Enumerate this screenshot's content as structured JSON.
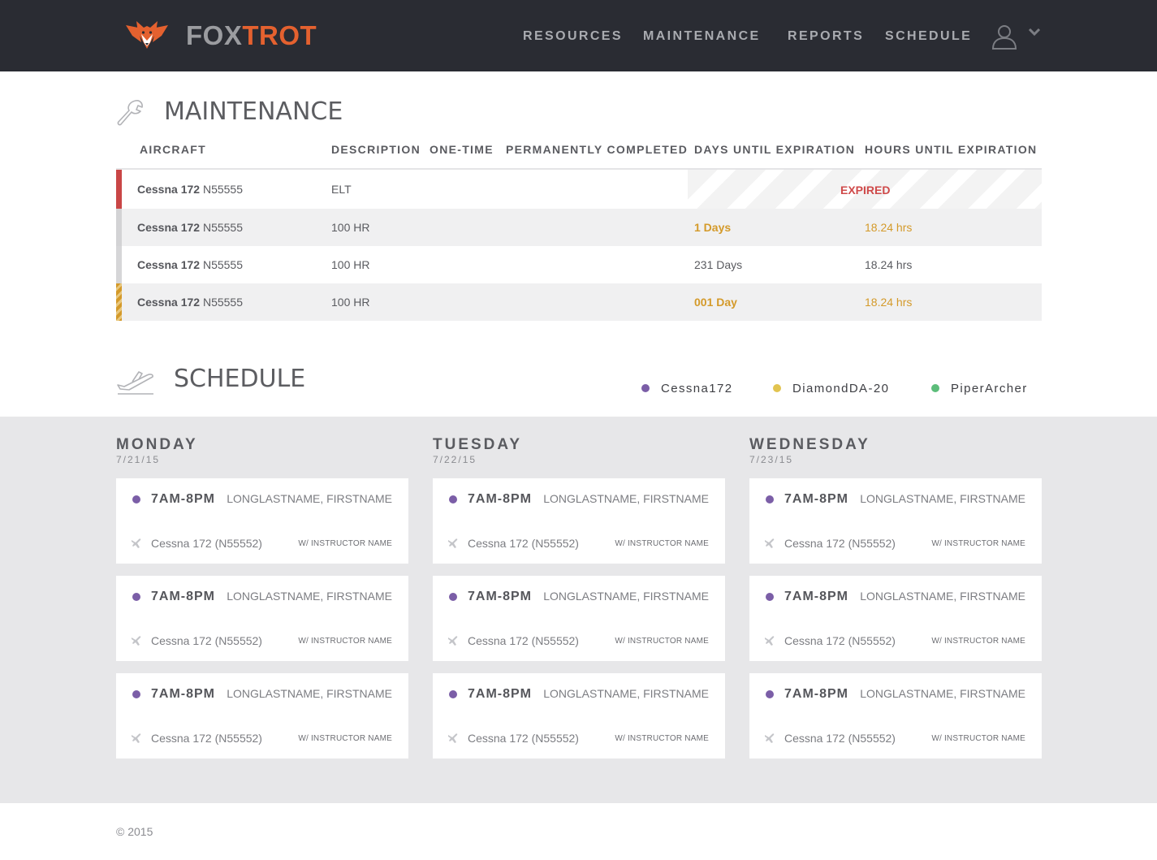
{
  "brand": {
    "name_part1": "FOX",
    "name_part2": "TROT"
  },
  "nav": {
    "items": [
      "RESOURCES",
      "MAINTENANCE",
      "REPORTS",
      "SCHEDULE"
    ]
  },
  "maintenance": {
    "title": "MAINTENANCE",
    "columns": [
      "AIRCRAFT",
      "DESCRIPTION",
      "ONE-TIME",
      "PERMANENTLY COMPLETED",
      "DAYS UNTIL EXPIRATION",
      "HOURS UNTIL EXPIRATION"
    ],
    "rows": [
      {
        "aircraft_model": "Cessna 172",
        "aircraft_reg": "N55555",
        "description": "ELT",
        "one_time": "",
        "permanently_completed": "",
        "days": "",
        "hours": "",
        "status_text": "EXPIRED",
        "status": "expired"
      },
      {
        "aircraft_model": "Cessna 172",
        "aircraft_reg": "N55555",
        "description": "100 HR",
        "one_time": "",
        "permanently_completed": "",
        "days": "1 Days",
        "hours": "18.24 hrs",
        "status_text": "",
        "status": "warning"
      },
      {
        "aircraft_model": "Cessna 172",
        "aircraft_reg": "N55555",
        "description": "100 HR",
        "one_time": "",
        "permanently_completed": "",
        "days": "231 Days",
        "hours": "18.24 hrs",
        "status_text": "",
        "status": "ok"
      },
      {
        "aircraft_model": "Cessna 172",
        "aircraft_reg": "N55555",
        "description": "100 HR",
        "one_time": "",
        "permanently_completed": "",
        "days": "001 Day",
        "hours": "18.24 hrs",
        "status_text": "",
        "status": "warning-striped"
      }
    ],
    "colors": {
      "expired": "#c94646",
      "warning": "#d49a2a",
      "ok": "#d6d6d8"
    }
  },
  "schedule": {
    "title": "SCHEDULE",
    "legend": [
      {
        "label": "Cessna172",
        "color": "#7b5ea7"
      },
      {
        "label": "DiamondDA-20",
        "color": "#e2c450"
      },
      {
        "label": "PiperArcher",
        "color": "#5cbd7a"
      }
    ],
    "days": [
      {
        "name": "MONDAY",
        "date": "7/21/15",
        "bookings": [
          {
            "time": "7AM-8PM",
            "person": "LONGLASTNAME, FIRSTNAME",
            "aircraft": "Cessna 172 (N55552)",
            "instructor": "W/ INSTRUCTOR NAME"
          },
          {
            "time": "7AM-8PM",
            "person": "LONGLASTNAME, FIRSTNAME",
            "aircraft": "Cessna 172 (N55552)",
            "instructor": "W/ INSTRUCTOR NAME"
          },
          {
            "time": "7AM-8PM",
            "person": "LONGLASTNAME, FIRSTNAME",
            "aircraft": "Cessna 172 (N55552)",
            "instructor": "W/ INSTRUCTOR NAME"
          }
        ]
      },
      {
        "name": "TUESDAY",
        "date": "7/22/15",
        "bookings": [
          {
            "time": "7AM-8PM",
            "person": "LONGLASTNAME, FIRSTNAME",
            "aircraft": "Cessna 172 (N55552)",
            "instructor": "W/ INSTRUCTOR NAME"
          },
          {
            "time": "7AM-8PM",
            "person": "LONGLASTNAME, FIRSTNAME",
            "aircraft": "Cessna 172 (N55552)",
            "instructor": "W/ INSTRUCTOR NAME"
          },
          {
            "time": "7AM-8PM",
            "person": "LONGLASTNAME, FIRSTNAME",
            "aircraft": "Cessna 172 (N55552)",
            "instructor": "W/ INSTRUCTOR NAME"
          }
        ]
      },
      {
        "name": "WEDNESDAY",
        "date": "7/23/15",
        "bookings": [
          {
            "time": "7AM-8PM",
            "person": "LONGLASTNAME, FIRSTNAME",
            "aircraft": "Cessna 172 (N55552)",
            "instructor": "W/ INSTRUCTOR NAME"
          },
          {
            "time": "7AM-8PM",
            "person": "LONGLASTNAME, FIRSTNAME",
            "aircraft": "Cessna 172 (N55552)",
            "instructor": "W/ INSTRUCTOR NAME"
          },
          {
            "time": "7AM-8PM",
            "person": "LONGLASTNAME, FIRSTNAME",
            "aircraft": "Cessna 172 (N55552)",
            "instructor": "W/ INSTRUCTOR NAME"
          }
        ]
      }
    ]
  },
  "footer": {
    "copyright": "© 2015"
  },
  "colors": {
    "topbar": "#2a2c33",
    "accent": "#e4612f",
    "band": "#e7e7e9"
  }
}
